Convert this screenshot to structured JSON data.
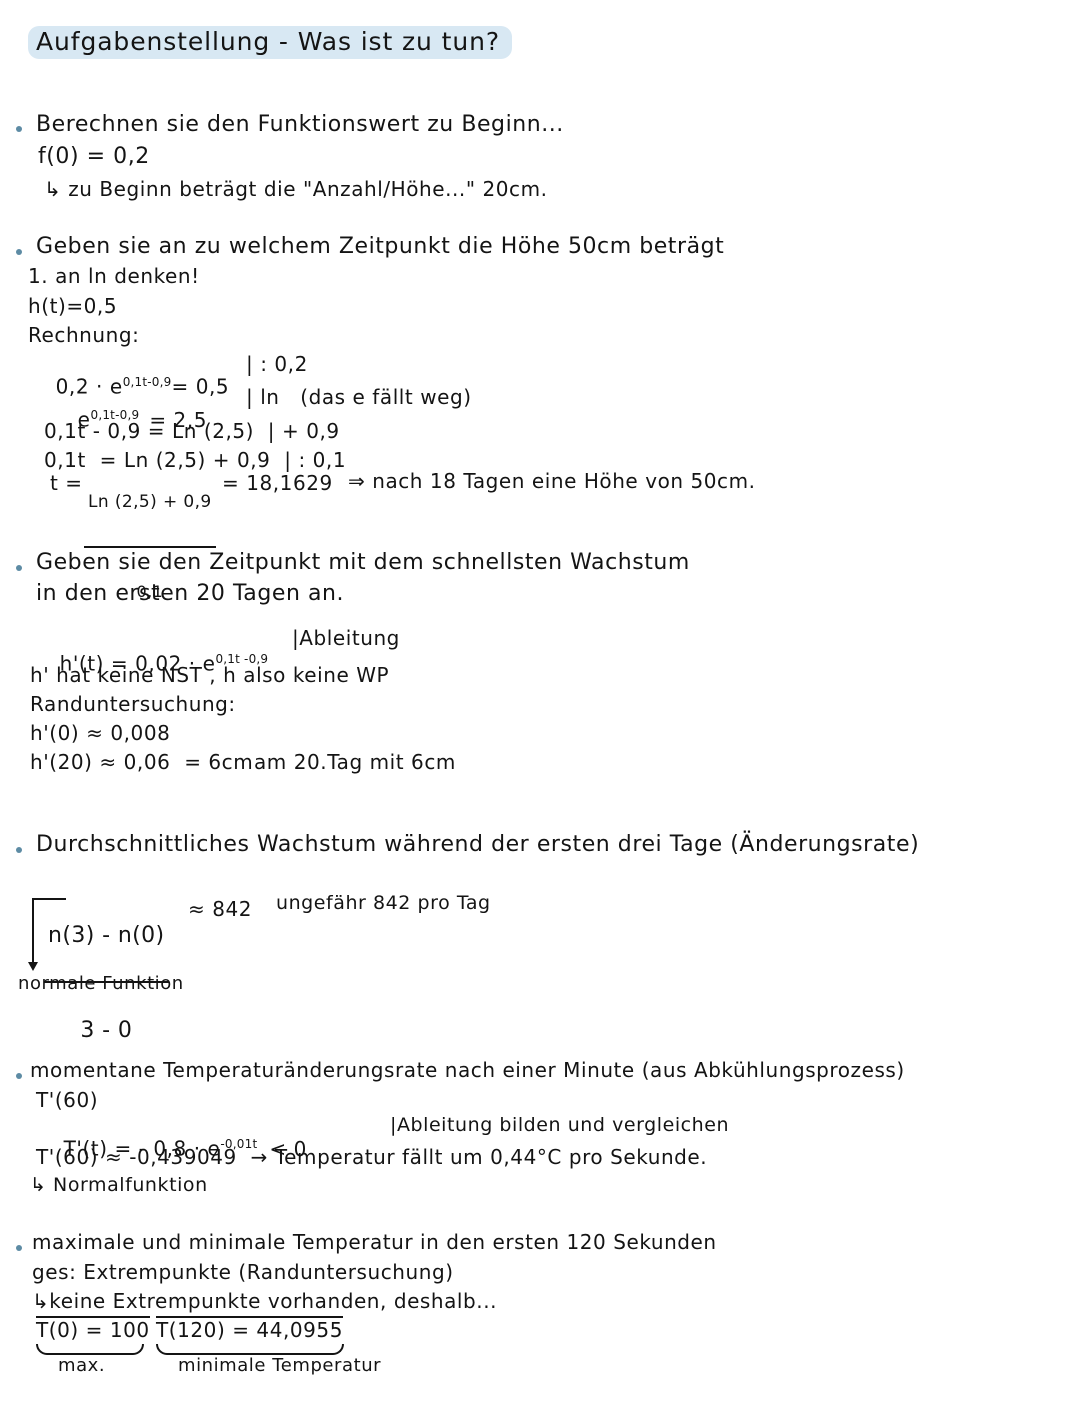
{
  "document": {
    "title": "Aufgabenstellung - Was ist zu tun?",
    "highlight_color": "#d8e8f3",
    "bullet_color": "#5d8ba4",
    "ink_color": "#141414",
    "background_color": "#ffffff"
  },
  "sections": {
    "s1": {
      "heading": "Berechnen sie den Funktionswert zu Beginn...",
      "line1": "f(0) = 0,2",
      "line2": "↳ zu Beginn beträgt die \"Anzahl/Höhe...\" 20cm."
    },
    "s2": {
      "heading": "Geben sie an zu welchem Zeitpunkt die Höhe 50cm beträgt",
      "line1": "1. an ln denken!",
      "line2": "h(t)=0,5",
      "line3": "Rechnung:",
      "eq1_left": "0,2 · e",
      "eq1_exp": "0,1t-0,9",
      "eq1_right": "= 0,5",
      "eq1_note": "| : 0,2",
      "eq2_left": "e",
      "eq2_exp": "0,1t-0,9",
      "eq2_right": "= 2,5",
      "eq2_note": "| ln   (das e fällt weg)",
      "eq3": "0,1t - 0,9 = Ln (2,5)  | + 0,9",
      "eq4": "0,1t  = Ln (2,5) + 0,9  | : 0,1",
      "eq5_t": "t =",
      "eq5_num": "Ln (2,5) + 0,9",
      "eq5_den": "0,1",
      "eq5_result": "= 18,1629",
      "eq5_concl": "⇒ nach 18 Tagen eine Höhe von 50cm."
    },
    "s3": {
      "heading1": "Geben sie den Zeitpunkt mit dem schnellsten Wachstum",
      "heading2": "in den ersten 20 Tagen an.",
      "eq1_left": "h'(t) = 0,02 · e",
      "eq1_exp": "0,1t -0,9",
      "eq1_note": "|Ableitung",
      "line1": "h' hat keine NST , h also keine WP",
      "line2": "Randuntersuchung:",
      "line3": "h'(0) ≈ 0,008",
      "line4": "h'(20) ≈ 0,06  = 6cm",
      "line4_note": "am 20.Tag mit 6cm"
    },
    "s4": {
      "heading": "Durchschnittliches Wachstum während der ersten drei Tage (Änderungsrate)",
      "frac_num": "n(3) - n(0)",
      "frac_den": "3 - 0",
      "result": "≈ 842",
      "note": "ungefähr 842 pro Tag",
      "annotation": "normale Funktion"
    },
    "s5": {
      "heading": "momentane Temperaturänderungsrate nach einer Minute (aus Abkühlungsprozess)",
      "line1": "T'(60)",
      "eq1_left": "T'(t) = - 0,8 · e",
      "eq1_exp": "-0,01t",
      "eq1_right": "< 0",
      "eq1_note": "|Ableitung bilden und vergleichen",
      "line2": "T'(60) ≈ -0,439049  → Temperatur fällt um 0,44°C pro Sekunde.",
      "line3": "↳ Normalfunktion"
    },
    "s6": {
      "heading1": "maximale und minimale Temperatur in den ersten 120 Sekunden",
      "heading2": "ges: Extrempunkte (Randuntersuchung)",
      "heading3": "↳keine Extrempunkte vorhanden, deshalb...",
      "value1": "T(0) = 100",
      "value1_label": "max.",
      "value2": "T(120) = 44,0955",
      "value2_label": "minimale Temperatur"
    }
  }
}
